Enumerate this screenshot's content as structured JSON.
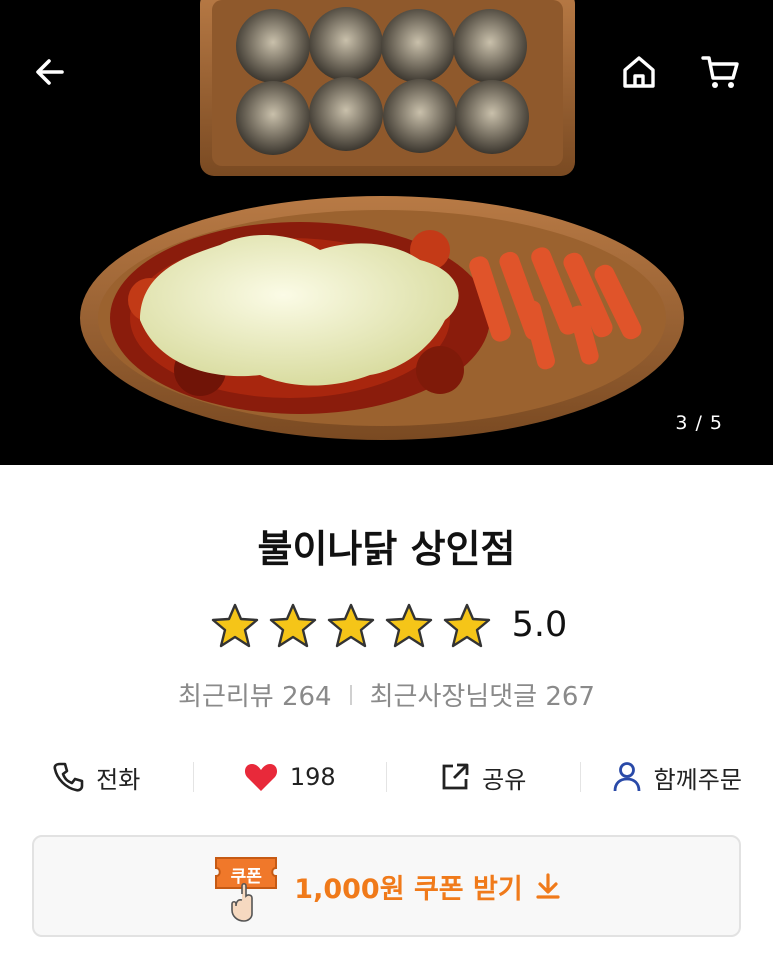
{
  "hero": {
    "image_desc_icon": "food-photo",
    "counter": "3 / 5",
    "back_icon": "arrow-left-icon",
    "home_icon": "home-icon",
    "cart_icon": "cart-icon"
  },
  "store": {
    "name": "불이나닭 상인점",
    "rating": 5.0,
    "rating_label": "5.0",
    "stars": 5,
    "recent_reviews": "최근리뷰 264",
    "owner_replies": "최근사장님댓글 267"
  },
  "actions": [
    {
      "label": "전화",
      "icon": "phone-icon"
    },
    {
      "label": "198",
      "icon": "heart-icon"
    },
    {
      "label": "공유",
      "icon": "share-icon"
    },
    {
      "label": "함께주문",
      "icon": "person-icon"
    }
  ],
  "coupon": {
    "badge_label": "쿠폰",
    "text": "1,000원 쿠폰 받기",
    "icon": "download-arrow-icon"
  },
  "colors": {
    "accent": "#f07a1a",
    "star": "#f5c518",
    "heart": "#e8293a",
    "person": "#2a4aa8"
  }
}
